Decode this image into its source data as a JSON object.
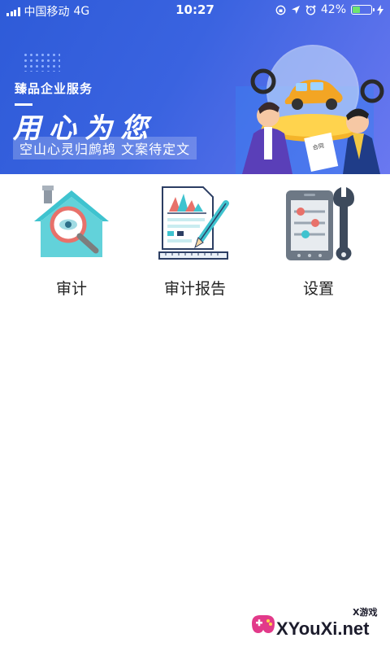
{
  "status_bar": {
    "carrier": "中国移动",
    "network": "4G",
    "time": "10:27",
    "battery": "42%",
    "battery_level": 0.42,
    "icons": [
      "signal-icon",
      "rotation-lock-icon",
      "location-icon",
      "alarm-icon",
      "battery-icon",
      "charging-icon"
    ]
  },
  "banner": {
    "subtitle": "臻品企业服务",
    "title": "用心为您",
    "tagline": "空山心灵归鹧鸪 文案待定文",
    "doc_label": "合同",
    "colors": {
      "start": "#2e5bd8",
      "end": "#6a78f0"
    }
  },
  "menu": {
    "items": [
      {
        "label": "审计",
        "icon": "house-magnifier-icon"
      },
      {
        "label": "审计报告",
        "icon": "report-pencil-icon"
      },
      {
        "label": "设置",
        "icon": "phone-wrench-icon"
      }
    ]
  },
  "watermark": {
    "site": "XYouXi.net",
    "tag": "X游戏"
  }
}
